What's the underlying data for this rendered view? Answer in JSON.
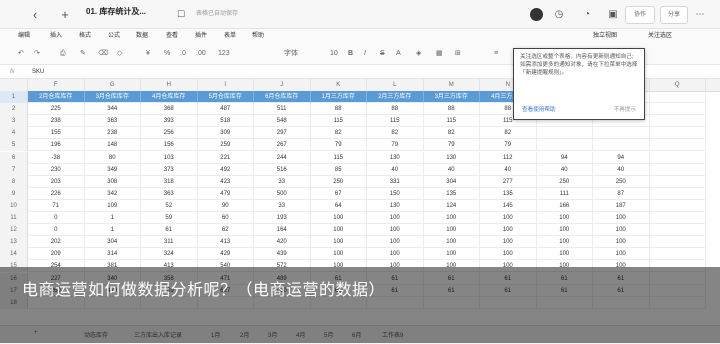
{
  "titlebar": {
    "doc_title": "01. 库存统计及...",
    "save_status": "表格已自动保存",
    "collab_label": "协作",
    "share_label": "分享"
  },
  "menubar": {
    "items": [
      "编辑",
      "插入",
      "格式",
      "公式",
      "数据",
      "查看",
      "插件",
      "表单",
      "帮助"
    ],
    "view_mode": "独立视图",
    "close_toolbar": "关注选区"
  },
  "toolbar": {
    "currency": "¥",
    "percent": "%",
    "decimal_dec": ".0",
    "decimal_inc": ".00",
    "number_format": "123",
    "font": "字体",
    "font_size": "10"
  },
  "formulabar": {
    "fx": "fx",
    "value": "SKU"
  },
  "grid": {
    "columns": [
      "F",
      "G",
      "H",
      "I",
      "J",
      "K",
      "L",
      "M",
      "N",
      "O",
      "P",
      "Q"
    ],
    "header_row": [
      "2月仓库库存",
      "3月仓库库存",
      "4月仓库库存",
      "5月仓库库存",
      "6月仓库库存",
      "1月三方库存",
      "2月三方库存",
      "3月三方库存",
      "4月三方库存",
      "",
      "",
      ""
    ],
    "rows": [
      [
        "225",
        "344",
        "368",
        "487",
        "511",
        "88",
        "88",
        "88",
        "88",
        "",
        "",
        ""
      ],
      [
        "238",
        "363",
        "393",
        "518",
        "548",
        "115",
        "115",
        "115",
        "115",
        "",
        "",
        ""
      ],
      [
        "155",
        "238",
        "256",
        "309",
        "297",
        "82",
        "82",
        "82",
        "82",
        "",
        "",
        ""
      ],
      [
        "196",
        "148",
        "156",
        "259",
        "267",
        "79",
        "79",
        "79",
        "79",
        "",
        "",
        ""
      ],
      [
        "-38",
        "80",
        "103",
        "221",
        "244",
        "115",
        "130",
        "130",
        "112",
        "94",
        "94",
        ""
      ],
      [
        "230",
        "349",
        "373",
        "492",
        "516",
        "85",
        "40",
        "40",
        "40",
        "40",
        "40",
        ""
      ],
      [
        "203",
        "308",
        "318",
        "423",
        "33",
        "250",
        "331",
        "304",
        "277",
        "250",
        "250",
        ""
      ],
      [
        "226",
        "342",
        "363",
        "479",
        "500",
        "67",
        "150",
        "135",
        "135",
        "111",
        "87",
        ""
      ],
      [
        "71",
        "109",
        "52",
        "90",
        "33",
        "64",
        "130",
        "124",
        "145",
        "166",
        "187",
        ""
      ],
      [
        "0",
        "1",
        "59",
        "60",
        "193",
        "100",
        "100",
        "100",
        "100",
        "100",
        "100",
        ""
      ],
      [
        "0",
        "1",
        "61",
        "62",
        "164",
        "100",
        "100",
        "100",
        "100",
        "100",
        "100",
        ""
      ],
      [
        "202",
        "304",
        "311",
        "413",
        "420",
        "100",
        "100",
        "100",
        "100",
        "100",
        "100",
        ""
      ],
      [
        "209",
        "314",
        "324",
        "429",
        "439",
        "100",
        "100",
        "100",
        "100",
        "100",
        "100",
        ""
      ],
      [
        "254",
        "381",
        "413",
        "540",
        "572",
        "100",
        "100",
        "100",
        "100",
        "100",
        "100",
        ""
      ],
      [
        "227",
        "340",
        "358",
        "471",
        "489",
        "61",
        "61",
        "61",
        "61",
        "61",
        "61",
        ""
      ],
      [
        "260",
        "470",
        "189",
        "627",
        "480",
        "61",
        "61",
        "61",
        "61",
        "61",
        "61",
        ""
      ],
      [
        "",
        "",
        "",
        "",
        "",
        "",
        "",
        "",
        "",
        "",
        "",
        ""
      ]
    ]
  },
  "popup": {
    "message": "关注选区或整个表格，内容有更新则通知自己; 如需添加更多的通知对象，请在下拉菜单中选择「新建提醒规则」。",
    "link": "查看使用帮助",
    "dismiss": "不再提示"
  },
  "sheet_tabs": [
    "动态库存",
    "三方库出入库记录",
    "1月",
    "2月",
    "3月",
    "4月",
    "5月",
    "6月",
    "工作表9"
  ],
  "banner": {
    "text": "电商运营如何做数据分析呢？（电商运营的数据）"
  },
  "colors": {
    "header_fill": "#5b9bd5",
    "accent": "#3b7ad9"
  }
}
